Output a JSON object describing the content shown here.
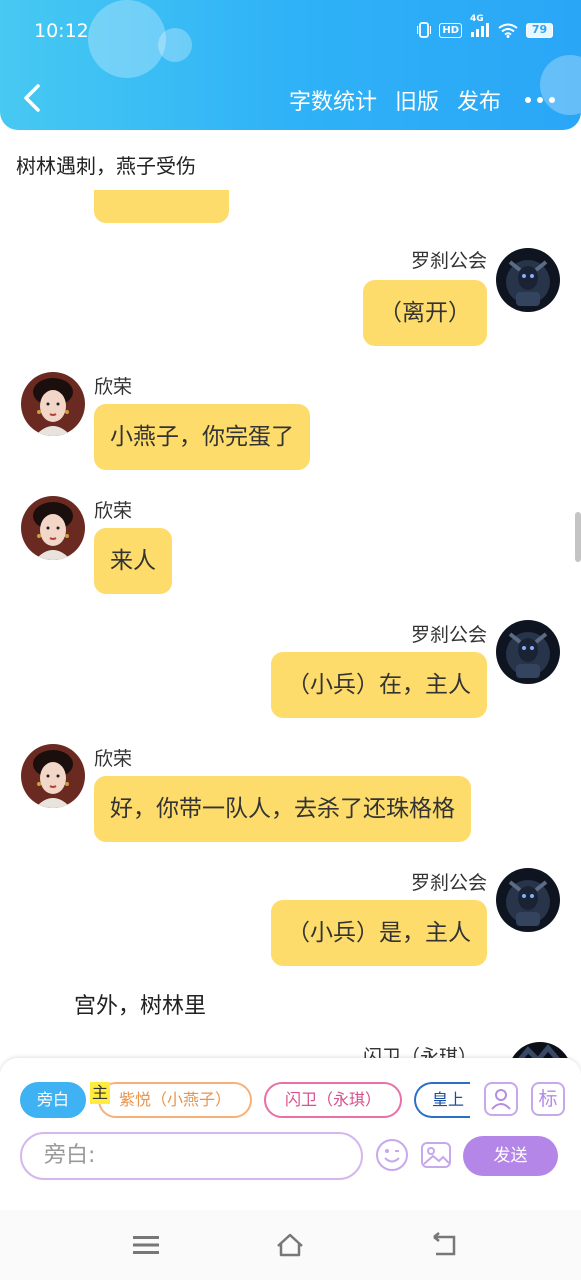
{
  "status_bar": {
    "time": "10:12",
    "network": "4G",
    "hd": "HD",
    "battery": "79"
  },
  "header": {
    "actions": [
      "字数统计",
      "旧版",
      "发布"
    ]
  },
  "chapter_title": "树林遇刺，燕子受伤",
  "messages": [
    {
      "side": "right",
      "sender": "罗刹公会",
      "text": "（离开）"
    },
    {
      "side": "left",
      "sender": "欣荣",
      "text": "小燕子，你完蛋了"
    },
    {
      "side": "left",
      "sender": "欣荣",
      "text": "来人"
    },
    {
      "side": "right",
      "sender": "罗刹公会",
      "text": "（小兵）在，主人"
    },
    {
      "side": "left",
      "sender": "欣荣",
      "text": "好，你带一队人，去杀了还珠格格"
    },
    {
      "side": "right",
      "sender": "罗刹公会",
      "text": "（小兵）是，主人"
    }
  ],
  "scene_text": "宫外，树林里",
  "partial_sender": "闪卫（永琪）",
  "role_chips": {
    "narration": "旁白",
    "main_tag": "主",
    "roles": [
      "紫悦（小燕子）",
      "闪卫（永琪）",
      "皇上"
    ],
    "mark_button": "标"
  },
  "composer": {
    "placeholder": "旁白:",
    "send_label": "发送"
  },
  "icons": [
    "back-icon",
    "more-icon",
    "add-role-icon",
    "emoji-icon",
    "image-icon",
    "menu-icon",
    "home-icon",
    "back-nav-icon"
  ],
  "colors": {
    "header": "#2fb2f7",
    "bubble": "#fddc6b",
    "send": "#b486e8",
    "active_chip": "#3fb2f3"
  }
}
